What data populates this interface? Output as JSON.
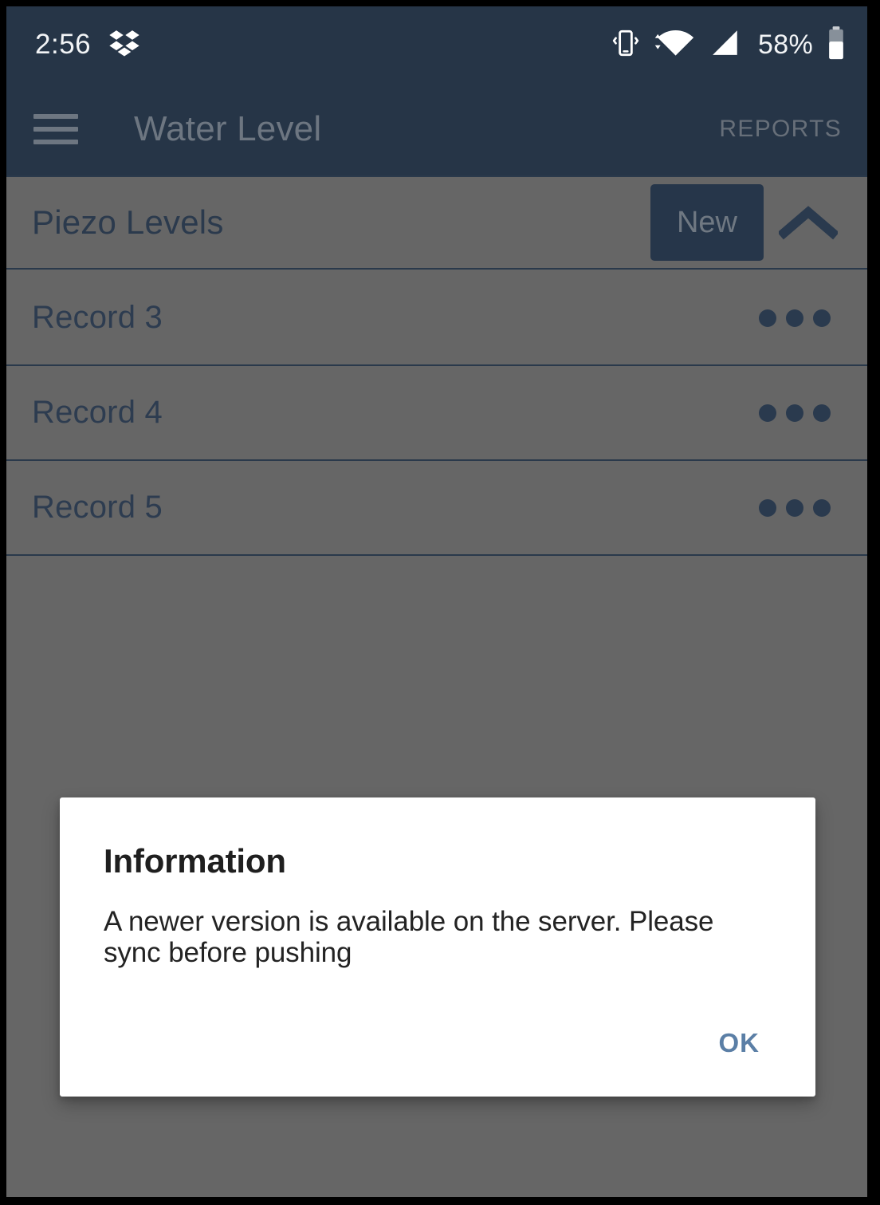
{
  "status_bar": {
    "clock": "2:56",
    "battery_percent": "58%",
    "icons": [
      "dropbox-icon",
      "vibrate-icon",
      "wifi-icon",
      "cellular-signal-icon",
      "battery-icon"
    ]
  },
  "app_bar": {
    "menu_icon": "hamburger-menu-icon",
    "title": "Water Level",
    "reports_label": "REPORTS"
  },
  "section": {
    "title": "Piezo Levels",
    "new_label": "New",
    "collapse_icon": "chevron-up-icon"
  },
  "records": [
    {
      "label": "Record 3",
      "overflow_icon": "overflow-menu-icon"
    },
    {
      "label": "Record 4",
      "overflow_icon": "overflow-menu-icon"
    },
    {
      "label": "Record 5",
      "overflow_icon": "overflow-menu-icon"
    }
  ],
  "dialog": {
    "title": "Information",
    "message": "A newer version is available on the server. Please sync before pushing",
    "ok_label": "OK"
  },
  "colors": {
    "app_bar": "#263547",
    "scrim_background": "#666666",
    "divider": "#2a394b",
    "new_button": "#26364a",
    "accent_text": "#2d3c50",
    "ok_button_text": "#5b7fa6",
    "dialog_background": "#ffffff"
  }
}
